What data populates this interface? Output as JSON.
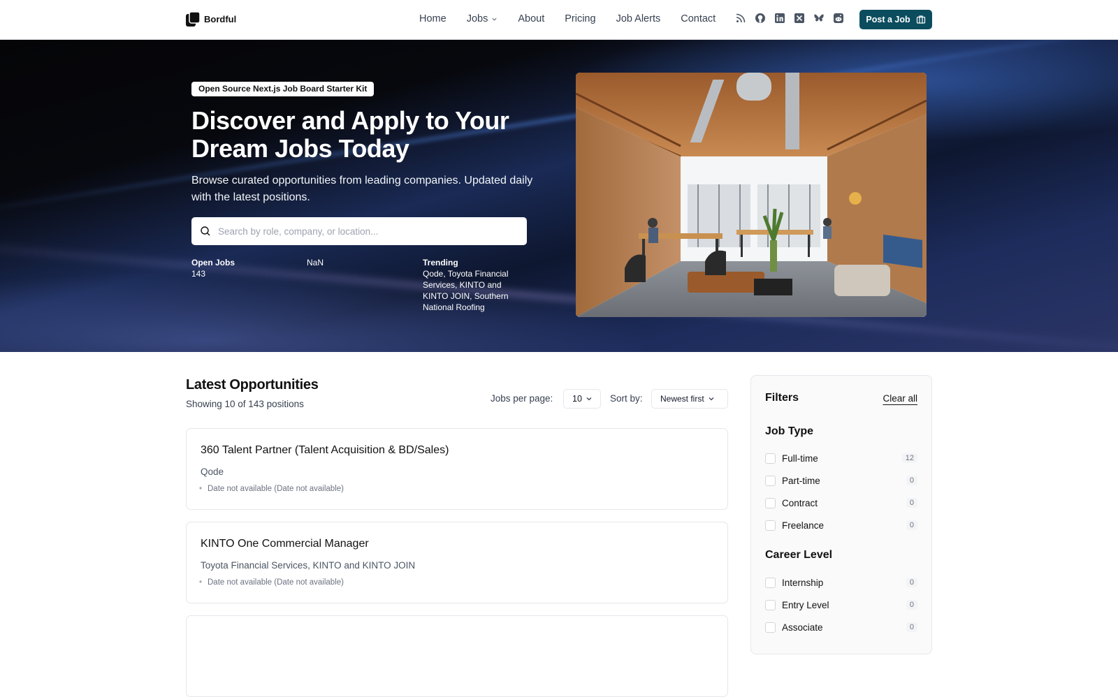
{
  "header": {
    "logo_text": "Bordful",
    "nav": [
      {
        "label": "Home"
      },
      {
        "label": "Jobs"
      },
      {
        "label": "About"
      },
      {
        "label": "Pricing"
      },
      {
        "label": "Job Alerts"
      },
      {
        "label": "Contact"
      }
    ],
    "social_icons": [
      "rss-icon",
      "github-icon",
      "linkedin-icon",
      "x-icon",
      "bluesky-icon",
      "reddit-icon"
    ],
    "post_button": "Post a Job",
    "accent_color": "#0b4d5e"
  },
  "hero": {
    "badge": "Open Source Next.js Job Board Starter Kit",
    "title": "Discover and Apply to Your Dream Jobs Today",
    "subtitle": "Browse curated opportunities from leading companies. Updated daily with the latest positions.",
    "search_placeholder": "Search by role, company, or location...",
    "stats": {
      "open_jobs_label": "Open Jobs",
      "open_jobs_value": "143",
      "nan_value": "NaN",
      "trending_label": "Trending",
      "trending_value": "Qode, Toyota Financial Services, KINTO and KINTO JOIN, Southern National Roofing"
    }
  },
  "main": {
    "title": "Latest Opportunities",
    "showing": "Showing 10 of 143 positions",
    "per_page_label": "Jobs per page:",
    "per_page_value": "10",
    "sort_label": "Sort by:",
    "sort_value": "Newest first",
    "jobs": [
      {
        "title": "360 Talent Partner (Talent Acquisition & BD/Sales)",
        "company": "Qode",
        "date": "Date not available (Date not available)"
      },
      {
        "title": "KINTO One Commercial Manager",
        "company": "Toyota Financial Services, KINTO and KINTO JOIN",
        "date": "Date not available (Date not available)"
      }
    ]
  },
  "filters": {
    "title": "Filters",
    "clear_all": "Clear all",
    "job_type_title": "Job Type",
    "job_type": [
      {
        "label": "Full-time",
        "count": "12"
      },
      {
        "label": "Part-time",
        "count": "0"
      },
      {
        "label": "Contract",
        "count": "0"
      },
      {
        "label": "Freelance",
        "count": "0"
      }
    ],
    "career_level_title": "Career Level",
    "career_level": [
      {
        "label": "Internship",
        "count": "0"
      },
      {
        "label": "Entry Level",
        "count": "0"
      },
      {
        "label": "Associate",
        "count": "0"
      }
    ]
  }
}
